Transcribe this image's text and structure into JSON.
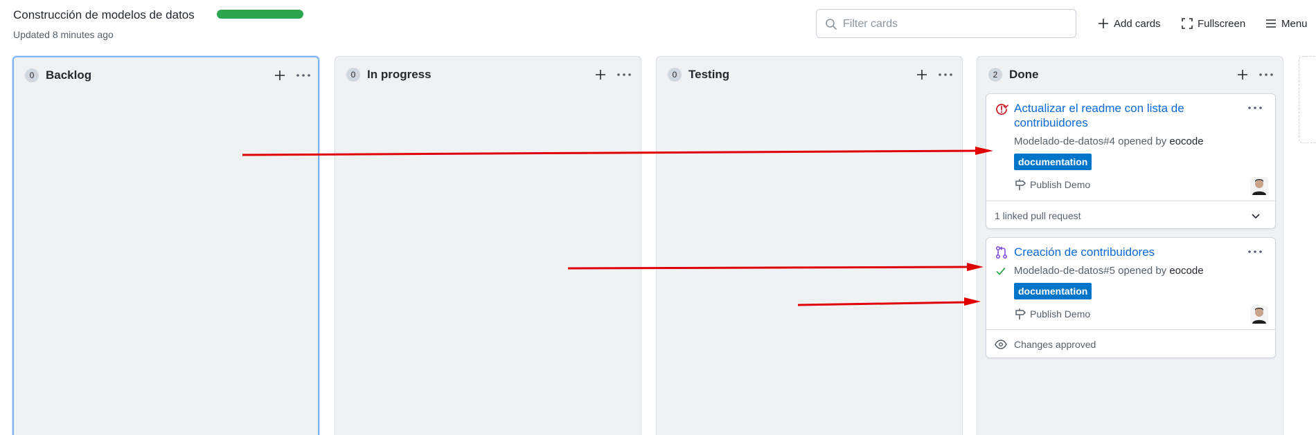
{
  "header": {
    "title": "Construcción de modelos de datos",
    "updated": "Updated 8 minutes ago",
    "progress_color": "#2da44e"
  },
  "search": {
    "placeholder": "Filter cards",
    "value": ""
  },
  "actions": {
    "add_cards": "Add cards",
    "fullscreen": "Fullscreen",
    "menu": "Menu"
  },
  "columns": [
    {
      "name": "Backlog",
      "count": "0"
    },
    {
      "name": "In progress",
      "count": "0"
    },
    {
      "name": "Testing",
      "count": "0"
    },
    {
      "name": "Done",
      "count": "2"
    }
  ],
  "cards": [
    {
      "type": "issue-closed",
      "title": "Actualizar el readme con lista de contribuidores",
      "meta_prefix": "Modelado-de-datos#4 opened by ",
      "author": "eocode",
      "label": "documentation",
      "label_color": "#0075ca",
      "milestone": "Publish Demo",
      "footer": "1 linked pull request"
    },
    {
      "type": "pull-request",
      "title": "Creación de contribuidores",
      "meta_prefix": "Modelado-de-datos#5 opened by ",
      "author": "eocode",
      "label": "documentation",
      "label_color": "#0075ca",
      "milestone": "Publish Demo",
      "footer": "Changes approved"
    }
  ],
  "colors": {
    "link": "#0969da",
    "closed_issue": "#cf222e",
    "pull_request": "#8250df",
    "success": "#2da44e",
    "annotation_arrow": "#e00000"
  }
}
